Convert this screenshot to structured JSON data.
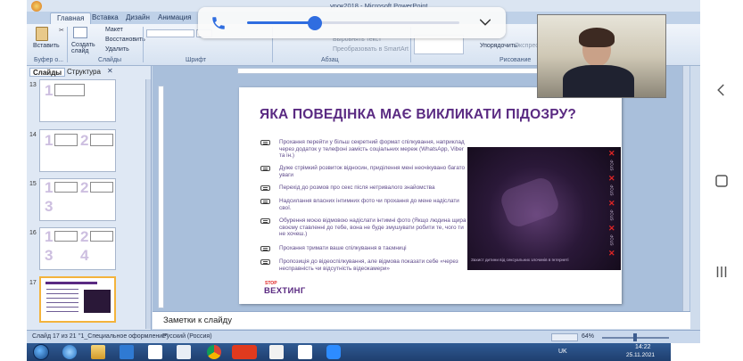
{
  "window": {
    "title": "урок2018 - Microsoft PowerPoint"
  },
  "ribbon": {
    "tabs": [
      "Главная",
      "Вставка",
      "Дизайн",
      "Анимация"
    ],
    "buttons": {
      "paste": "Вставить",
      "new_slide": "Создать слайд",
      "layout": "Макет",
      "reset": "Восстановить",
      "delete": "Удалить",
      "text_direction": "Выровнять текст",
      "smartart": "Преобразовать в SmartArt",
      "arrange": "Упорядочить",
      "express": "Экспресс"
    },
    "groups": [
      "Буфер о...",
      "Слайды",
      "Шрифт",
      "Абзац",
      "Рисование"
    ]
  },
  "left_pane": {
    "tabs": [
      "Слайды",
      "Структура"
    ],
    "slide_numbers": [
      "13",
      "14",
      "15",
      "16",
      "17"
    ]
  },
  "slide": {
    "title": "ЯКА ПОВЕДІНКА МАЄ ВИКЛИКАТИ ПІДОЗРУ?",
    "bullets": [
      "Прохання перейти у більш секретний формат спілкування, наприклад через додаток у телефоні замість соціальних мереж (WhatsApp, Viber та ін.)",
      "Дуже стрімкий розвиток відносин, приділення мені неочікувано багато уваги",
      "Перехід до розмов про секс після нетривалого знайомства",
      "Надсилання власних інтимних фото чи прохання до мене надіслати свої.",
      "Обурення моєю відмовою надіслати інтимні фото (Якщо людина щира у своєму ставленні до тебе, вона не буде змушувати робити те, чого ти не хочеш.)",
      "Прохання тримати ваше спілкування в таємниці",
      "Пропозиція до відеоспілкування, але відмова показати себе «через несправність чи відсутність відеокамери»"
    ],
    "photo_caption": "Захист дитини від сексуальних злочинів в Інтернеті",
    "photo_side_word": "STOP",
    "logo_top": "STOP",
    "logo_main": "ВЕХТИНГ"
  },
  "notes": {
    "placeholder": "Заметки к слайду"
  },
  "status": {
    "slide": "Слайд 17 из 21",
    "theme": "\"1_Специальное оформление\"",
    "language": "Русский (Россия)",
    "zoom": "64%"
  },
  "taskbar": {
    "language": "UK",
    "time": "14:22",
    "date": "25.11.2021"
  },
  "call": {
    "volume_percent": 0.32
  },
  "colors": {
    "accent": "#5a2a82",
    "stop_red": "#e02525",
    "call_blue": "#2f6de0"
  }
}
